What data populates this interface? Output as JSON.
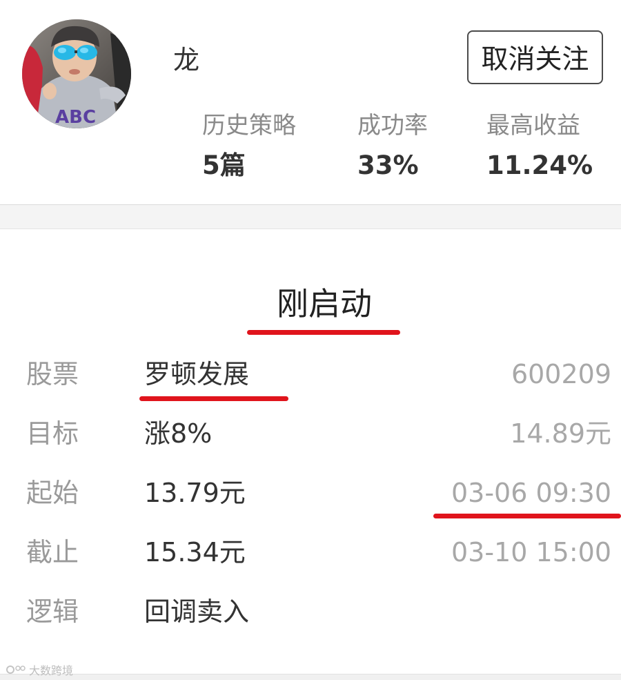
{
  "profile": {
    "username": "龙",
    "follow_button": "取消关注",
    "stats": [
      {
        "label": "历史策略",
        "value": "5篇"
      },
      {
        "label": "成功率",
        "value": "33%"
      },
      {
        "label": "最高收益",
        "value": "11.24%"
      }
    ]
  },
  "strategy": {
    "status": "刚启动",
    "rows": [
      {
        "label": "股票",
        "value": "罗顿发展",
        "extra": "600209"
      },
      {
        "label": "目标",
        "value": "涨8%",
        "extra": "14.89元"
      },
      {
        "label": "起始",
        "value": "13.79元",
        "extra": "03-06 09:30"
      },
      {
        "label": "截止",
        "value": "15.34元",
        "extra": "03-10 15:00"
      },
      {
        "label": "逻辑",
        "value": "回调卖入",
        "extra": ""
      }
    ]
  },
  "watermark": {
    "text": "大数跨境",
    "icon": "logo-icon"
  },
  "colors": {
    "underline_mark": "#e0141c",
    "label_gray": "#9a9a9a",
    "text_dark": "#333333"
  }
}
